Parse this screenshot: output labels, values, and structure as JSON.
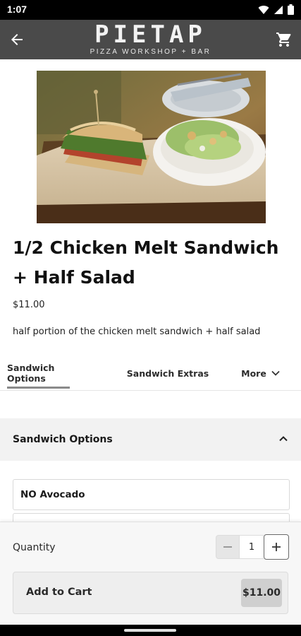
{
  "status_bar": {
    "time": "1:07"
  },
  "header": {
    "logo_title": "PIETAP",
    "logo_subtitle": "PIZZA WORKSHOP + BAR",
    "back_icon": "arrow-left-icon",
    "cart_icon": "shopping-cart-icon"
  },
  "product": {
    "title": "1/2 Chicken Melt Sandwich + Half Salad",
    "price": "$11.00",
    "description": "half portion of the chicken melt sandwich + half salad"
  },
  "tabs": [
    {
      "label": "Sandwich Options",
      "active": true
    },
    {
      "label": "Sandwich Extras",
      "active": false
    },
    {
      "label": "More",
      "active": false
    }
  ],
  "section": {
    "title": "Sandwich Options",
    "options": [
      {
        "label": "NO Avocado"
      }
    ]
  },
  "cart": {
    "quantity_label": "Quantity",
    "quantity": "1",
    "add_label": "Add to Cart",
    "price": "$11.00"
  },
  "colors": {
    "app_bar": "#4a4a4a",
    "status_bar": "#000000",
    "section_bg": "#f2f2f2",
    "price_badge": "#cfcfcf"
  }
}
